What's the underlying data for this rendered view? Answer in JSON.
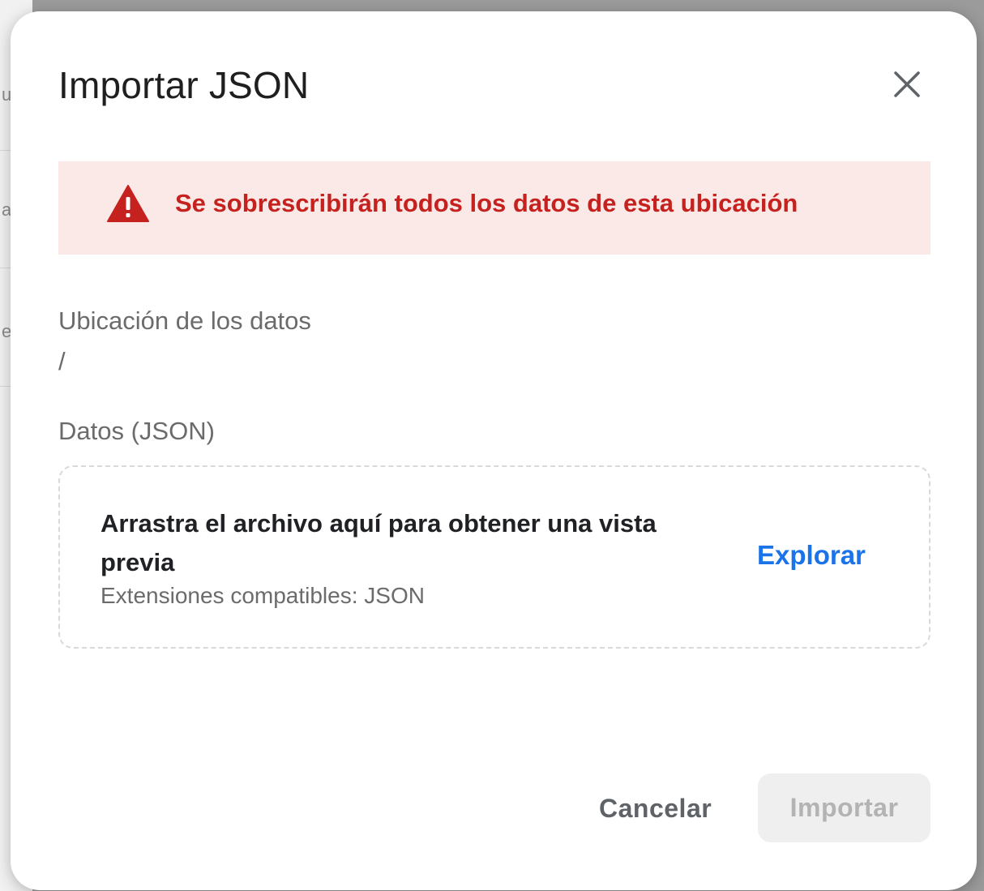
{
  "background": {
    "letters": [
      "u",
      "a",
      "e"
    ]
  },
  "dialog": {
    "title": "Importar JSON",
    "close_icon": "close-icon",
    "warning": {
      "icon": "warning-triangle-icon",
      "text": "Se sobrescribirán todos los datos de esta ubicación",
      "color": "#c5221f",
      "background": "#fbe9e7"
    },
    "location": {
      "label": "Ubicación de los datos",
      "value": "/"
    },
    "data_field": {
      "label": "Datos (JSON)"
    },
    "dropzone": {
      "title": "Arrastra el archivo aquí para obtener una vista previa",
      "hint": "Extensiones compatibles: JSON",
      "browse_label": "Explorar"
    },
    "actions": {
      "cancel_label": "Cancelar",
      "import_label": "Importar",
      "import_disabled": true
    },
    "accent_color": "#1a73e8"
  }
}
